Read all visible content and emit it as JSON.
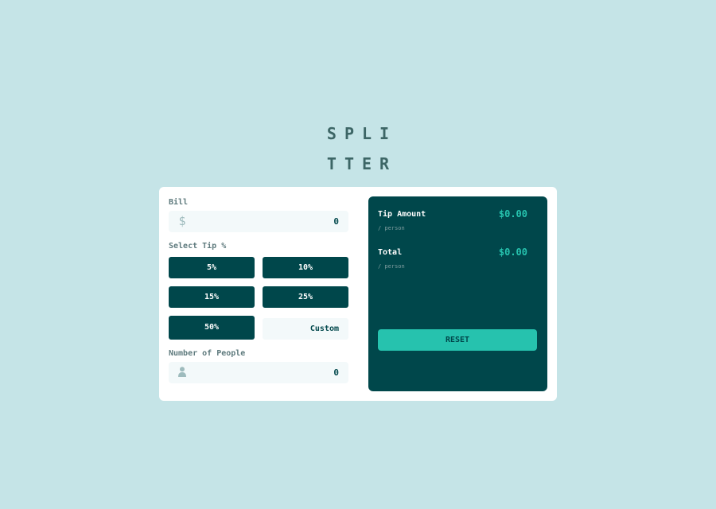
{
  "app": {
    "logo_line1": "SPLI",
    "logo_line2": "TTER"
  },
  "bill": {
    "label": "Bill",
    "icon": "dollar-icon",
    "icon_glyph": "$",
    "value": "0"
  },
  "tip": {
    "label": "Select Tip %",
    "options": [
      "5%",
      "10%",
      "15%",
      "25%",
      "50%"
    ],
    "custom_label": "Custom"
  },
  "people": {
    "label": "Number of People",
    "icon": "person-icon",
    "value": "0"
  },
  "results": {
    "tip_amount_label": "Tip Amount",
    "tip_amount_sub": "/ person",
    "tip_amount_value": "$0.00",
    "total_label": "Total",
    "total_sub": "/ person",
    "total_value": "$0.00",
    "reset_label": "RESET"
  },
  "colors": {
    "background": "#c5e4e7",
    "card": "#ffffff",
    "dark_cyan": "#00474b",
    "strong_cyan": "#26c2ae",
    "input_bg": "#f3f9fa",
    "label_gray": "#5e7a7d"
  }
}
